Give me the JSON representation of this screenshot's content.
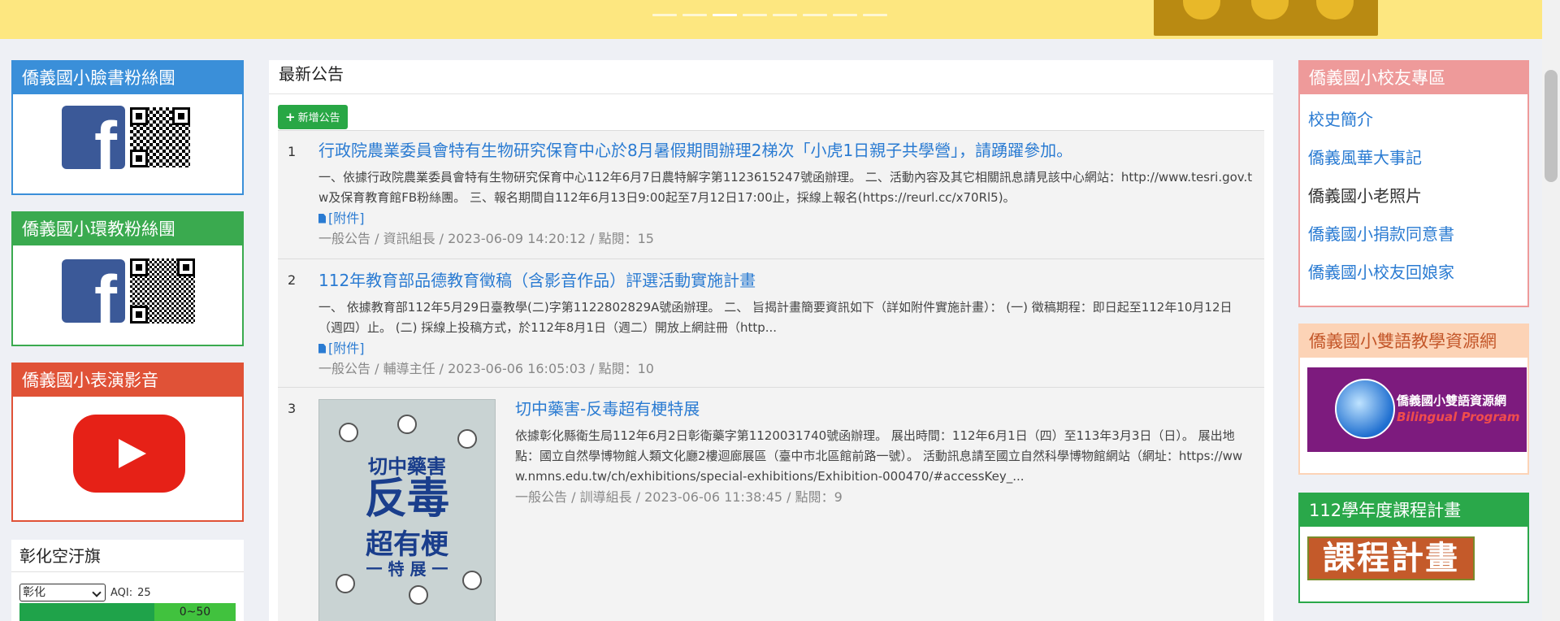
{
  "banner": {
    "slide_count": 8,
    "active_slide": 3
  },
  "left": {
    "fb_panel_1": {
      "title": "僑義國小臉書粉絲團",
      "color": "#3a8fd9"
    },
    "fb_panel_2": {
      "title": "僑義國小環教粉絲團",
      "color": "#3aaa4f"
    },
    "video_panel": {
      "title": "僑義國小表演影音",
      "color": "#e05237"
    },
    "aqi": {
      "title": "彰化空汙旗",
      "select_value": "彰化",
      "aqi_label": "AQI:",
      "aqi_value": "25",
      "level_label": "0~50"
    }
  },
  "main": {
    "title": "最新公告",
    "add_button": "新增公告",
    "items": [
      {
        "num": "1",
        "title": "行政院農業委員會特有生物研究保育中心於8月暑假期間辦理2梯次「小虎1日親子共學營」，請踴躍參加。",
        "body": "一、依據行政院農業委員會特有生物研究保育中心112年6月7日農特解字第1123615247號函辦理。 二、活動內容及其它相關訊息請見該中心網站：http://www.tesri.gov.tw及保育教育館FB粉絲團。 三、報名期間自112年6月13日9:00起至7月12日17:00止，採線上報名(https://reurl.cc/x70Rl5)。",
        "attach": "[附件]",
        "meta": "一般公告 / 資訊組長 / 2023-06-09 14:20:12 / 點閱：15"
      },
      {
        "num": "2",
        "title": "112年教育部品德教育徵稿（含影音作品）評選活動實施計畫",
        "body": "一、 依據教育部112年5月29日臺教學(二)字第1122802829A號函辦理。 二、 旨揭計畫簡要資訊如下（詳如附件實施計畫）： (一) 徵稿期程：即日起至112年10月12日（週四）止。 (二) 採線上投稿方式，於112年8月1日（週二）開放上網註冊（http...",
        "attach": "[附件]",
        "meta": "一般公告 / 輔導主任 / 2023-06-06 16:05:03 / 點閱：10"
      },
      {
        "num": "3",
        "title": "切中藥害-反毒超有梗特展",
        "body": "依據彰化縣衛生局112年6月2日彰衛藥字第1120031740號函辦理。 展出時間：112年6月1日（四）至113年3月3日（日）。 展出地點：國立自然學博物館人類文化廳2樓迴廊展區（臺中市北區館前路一號）。 活動訊息請至國立自然科學博物館網站（網址：https://www.nmns.edu.tw/ch/exhibitions/special-exhibitions/Exhibition-000470/#accessKey_...",
        "meta": "一般公告 / 訓導組長 / 2023-06-06 11:38:45 / 點閱：9",
        "poster": {
          "line1": "切中藥害",
          "line2": "反毒",
          "line3": "超有梗",
          "line4": "一 特 展 一"
        }
      }
    ]
  },
  "right": {
    "alumni": {
      "title": "僑義國小校友專區",
      "color": "#ee9a9a",
      "links": [
        {
          "label": "校史簡介"
        },
        {
          "label": "僑義風華大事記"
        },
        {
          "label": "僑義國小老照片"
        },
        {
          "label": "僑義國小捐款同意書"
        },
        {
          "label": "僑義國小校友回娘家"
        }
      ]
    },
    "bilingual": {
      "title": "僑義國小雙語教學資源網",
      "color": "#fcd3b6",
      "img_line1": "僑義國小雙語資源網",
      "img_line2": "Bilingual Program"
    },
    "course": {
      "title": "112學年度課程計畫",
      "color": "#2aa84a",
      "img_text": "課程計畫"
    }
  }
}
